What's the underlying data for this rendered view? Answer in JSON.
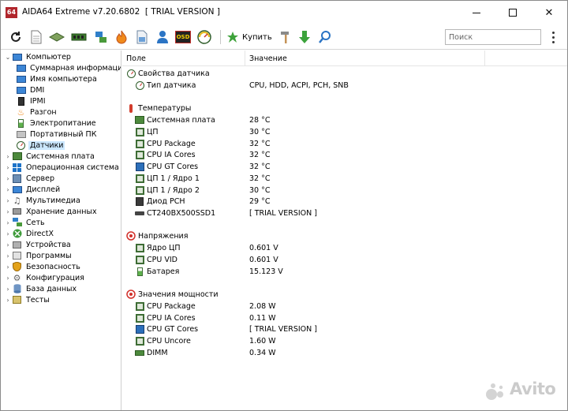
{
  "window": {
    "app_icon_text": "64",
    "title": "AIDA64 Extreme v7.20.6802  [ TRIAL VERSION ]",
    "minimize_label": "—",
    "maximize_label": "☐",
    "close_label": "✕"
  },
  "toolbar": {
    "icons": [
      "refresh-icon",
      "report-icon",
      "motherboard-icon",
      "memory-icon",
      "network-icon",
      "flame-icon",
      "file-icon",
      "user-icon",
      "osd-icon",
      "gauge-icon"
    ],
    "osd_label": "OSD",
    "buy_label": "Купить",
    "search_placeholder": "Поиск"
  },
  "tree": {
    "root_label": "Компьютер",
    "children": [
      {
        "label": "Суммарная информация",
        "icon": "monitor-icon"
      },
      {
        "label": "Имя компьютера",
        "icon": "monitor-icon"
      },
      {
        "label": "DMI",
        "icon": "monitor-icon"
      },
      {
        "label": "IPMI",
        "icon": "device-icon"
      },
      {
        "label": "Разгон",
        "icon": "flame-icon"
      },
      {
        "label": "Электропитание",
        "icon": "battery-icon"
      },
      {
        "label": "Портативный ПК",
        "icon": "laptop-icon"
      },
      {
        "label": "Датчики",
        "icon": "gauge-icon",
        "selected": true
      }
    ],
    "sections": [
      {
        "label": "Системная плата",
        "icon": "motherboard-icon"
      },
      {
        "label": "Операционная система",
        "icon": "windows-icon"
      },
      {
        "label": "Сервер",
        "icon": "server-icon"
      },
      {
        "label": "Дисплей",
        "icon": "display-icon"
      },
      {
        "label": "Мультимедиа",
        "icon": "multimedia-icon"
      },
      {
        "label": "Хранение данных",
        "icon": "storage-icon"
      },
      {
        "label": "Сеть",
        "icon": "network-icon"
      },
      {
        "label": "DirectX",
        "icon": "xbox-icon"
      },
      {
        "label": "Устройства",
        "icon": "devices-icon"
      },
      {
        "label": "Программы",
        "icon": "programs-icon"
      },
      {
        "label": "Безопасность",
        "icon": "shield-icon"
      },
      {
        "label": "Конфигурация",
        "icon": "config-icon"
      },
      {
        "label": "База данных",
        "icon": "database-icon"
      },
      {
        "label": "Тесты",
        "icon": "tests-icon"
      }
    ]
  },
  "list": {
    "col_field": "Поле",
    "col_value": "Значение",
    "groups": [
      {
        "title": "Свойства датчика",
        "icon": "gauge-icon",
        "rows": [
          {
            "field": "Тип датчика",
            "value": "CPU, HDD, ACPI, PCH, SNB",
            "icon": "gauge-icon"
          }
        ]
      },
      {
        "title": "Температуры",
        "icon": "thermometer-icon",
        "rows": [
          {
            "field": "Системная плата",
            "value": "28 °C",
            "icon": "motherboard-icon"
          },
          {
            "field": "ЦП",
            "value": "30 °C",
            "icon": "cpu-icon"
          },
          {
            "field": "CPU Package",
            "value": "32 °C",
            "icon": "cpu-icon"
          },
          {
            "field": "CPU IA Cores",
            "value": "32 °C",
            "icon": "cpu-icon"
          },
          {
            "field": "CPU GT Cores",
            "value": "32 °C",
            "icon": "gpu-icon"
          },
          {
            "field": "ЦП 1 / Ядро 1",
            "value": "32 °C",
            "icon": "cpu-icon"
          },
          {
            "field": "ЦП 1 / Ядро 2",
            "value": "30 °C",
            "icon": "cpu-icon"
          },
          {
            "field": "Диод PCH",
            "value": "29 °C",
            "icon": "diode-icon"
          },
          {
            "field": "CT240BX500SSD1",
            "value": "[ TRIAL VERSION ]",
            "icon": "drive-icon"
          }
        ]
      },
      {
        "title": "Напряжения",
        "icon": "voltage-icon",
        "rows": [
          {
            "field": "Ядро ЦП",
            "value": "0.601 V",
            "icon": "cpu-icon"
          },
          {
            "field": "CPU VID",
            "value": "0.601 V",
            "icon": "cpu-icon"
          },
          {
            "field": "Батарея",
            "value": "15.123 V",
            "icon": "battery-icon"
          }
        ]
      },
      {
        "title": "Значения мощности",
        "icon": "power-icon",
        "rows": [
          {
            "field": "CPU Package",
            "value": "2.08 W",
            "icon": "cpu-icon"
          },
          {
            "field": "CPU IA Cores",
            "value": "0.11 W",
            "icon": "cpu-icon"
          },
          {
            "field": "CPU GT Cores",
            "value": "[ TRIAL VERSION ]",
            "icon": "gpu-icon"
          },
          {
            "field": "CPU Uncore",
            "value": "1.60 W",
            "icon": "cpu-icon"
          },
          {
            "field": "DIMM",
            "value": "0.34 W",
            "icon": "memory-icon"
          }
        ]
      }
    ]
  },
  "watermark": "Avito"
}
